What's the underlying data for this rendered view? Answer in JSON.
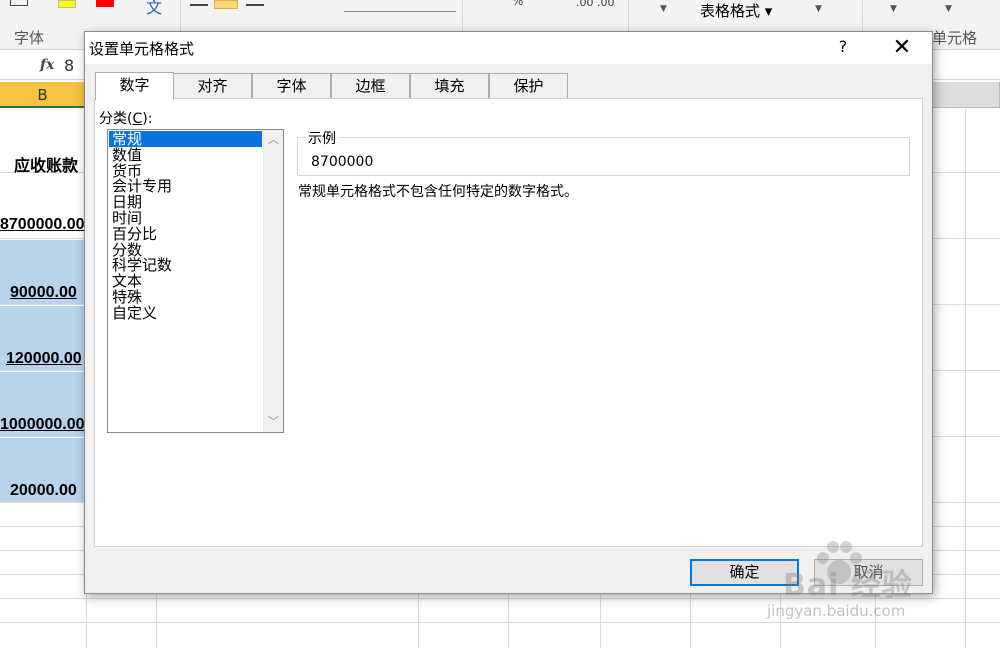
{
  "excel": {
    "ribbon": {
      "font_group_label": "字体",
      "table_format_label": "表格格式",
      "cell_style_group_label": "单元格",
      "fill_color": "#ffff00",
      "font_color": "#ff0000"
    },
    "formula_bar": {
      "fx_label": "fx",
      "value": "8"
    },
    "column_header": "B",
    "cells": [
      {
        "text": "应收账款",
        "highlighted": false
      },
      {
        "text": "8700000.00",
        "highlighted": false
      },
      {
        "text": "90000.00",
        "highlighted": true
      },
      {
        "text": "120000.00",
        "highlighted": true
      },
      {
        "text": "1000000.00",
        "highlighted": true
      },
      {
        "text": "20000.00",
        "highlighted": true
      }
    ]
  },
  "dialog": {
    "title": "设置单元格格式",
    "help_label": "?",
    "close_label": "✕",
    "tabs": [
      {
        "label": "数字",
        "active": true
      },
      {
        "label": "对齐",
        "active": false
      },
      {
        "label": "字体",
        "active": false
      },
      {
        "label": "边框",
        "active": false
      },
      {
        "label": "填充",
        "active": false
      },
      {
        "label": "保护",
        "active": false
      }
    ],
    "category_label_prefix": "分类(",
    "category_label_key": "C",
    "category_label_suffix": "):",
    "categories": [
      "常规",
      "数值",
      "货币",
      "会计专用",
      "日期",
      "时间",
      "百分比",
      "分数",
      "科学记数",
      "文本",
      "特殊",
      "自定义"
    ],
    "selected_category": "常规",
    "sample_label": "示例",
    "sample_value": "8700000",
    "description": "常规单元格格式不包含任何特定的数字格式。",
    "ok_label": "确定",
    "cancel_label": "取消"
  },
  "watermark": {
    "main": "Bai 经验",
    "sub": "jingyan.baidu.com"
  },
  "colors": {
    "selection": "#0a73d9",
    "cell_highlight": "#b8d3ea",
    "column_active": "#f5c342"
  }
}
